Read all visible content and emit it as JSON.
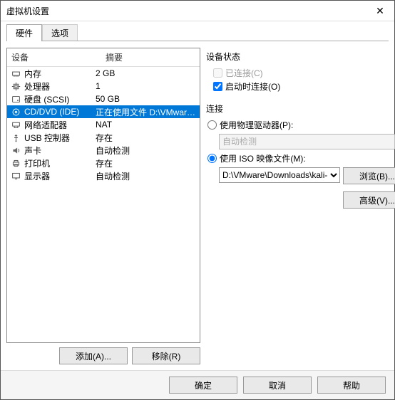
{
  "window": {
    "title": "虚拟机设置"
  },
  "tabs": {
    "hardware": "硬件",
    "options": "选项"
  },
  "table": {
    "col_device": "设备",
    "col_summary": "摘要",
    "rows": [
      {
        "icon": "memory",
        "name": "内存",
        "summary": "2 GB"
      },
      {
        "icon": "cpu",
        "name": "处理器",
        "summary": "1"
      },
      {
        "icon": "disk",
        "name": "硬盘 (SCSI)",
        "summary": "50 GB"
      },
      {
        "icon": "cd",
        "name": "CD/DVD (IDE)",
        "summary": "正在使用文件 D:\\VMware\\Dow..."
      },
      {
        "icon": "net",
        "name": "网络适配器",
        "summary": "NAT"
      },
      {
        "icon": "usb",
        "name": "USB 控制器",
        "summary": "存在"
      },
      {
        "icon": "sound",
        "name": "声卡",
        "summary": "自动检测"
      },
      {
        "icon": "printer",
        "name": "打印机",
        "summary": "存在"
      },
      {
        "icon": "display",
        "name": "显示器",
        "summary": "自动检测"
      }
    ],
    "selected_index": 3
  },
  "buttons": {
    "add": "添加(A)...",
    "remove": "移除(R)",
    "browse": "浏览(B)...",
    "advanced": "高级(V)...",
    "ok": "确定",
    "cancel": "取消",
    "help": "帮助"
  },
  "status": {
    "title": "设备状态",
    "connected": "已连接(C)",
    "connect_at_poweron": "启动时连接(O)"
  },
  "connection": {
    "title": "连接",
    "use_physical": "使用物理驱动器(P):",
    "physical_value": "自动检测",
    "use_iso": "使用 ISO 映像文件(M):",
    "iso_value": "D:\\VMware\\Downloads\\kali-"
  }
}
